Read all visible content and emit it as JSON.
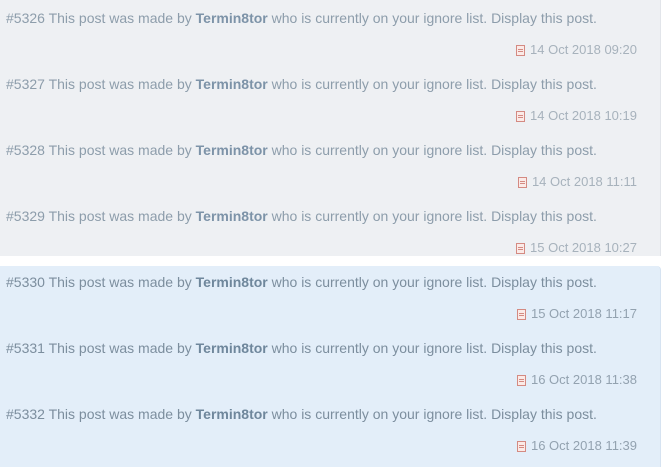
{
  "posts": [
    {
      "number": "#5326",
      "pre": " This post was made by ",
      "author": "Termin8tor",
      "mid": " who is currently on your ignore list. ",
      "display": "Display this post.",
      "date": "14 Oct 2018 09:20"
    },
    {
      "number": "#5327",
      "pre": " This post was made by ",
      "author": "Termin8tor",
      "mid": " who is currently on your ignore list. ",
      "display": "Display this post.",
      "date": "14 Oct 2018 10:19"
    },
    {
      "number": "#5328",
      "pre": " This post was made by ",
      "author": "Termin8tor",
      "mid": " who is currently on your ignore list. ",
      "display": "Display this post.",
      "date": "14 Oct 2018 11:11"
    },
    {
      "number": "#5329",
      "pre": " This post was made by ",
      "author": "Termin8tor",
      "mid": " who is currently on your ignore list. ",
      "display": "Display this post.",
      "date": "15 Oct 2018 10:27"
    },
    {
      "number": "#5330",
      "pre": " This post was made by ",
      "author": "Termin8tor",
      "mid": " who is currently on your ignore list. ",
      "display": "Display this post.",
      "date": "15 Oct 2018 11:17"
    },
    {
      "number": "#5331",
      "pre": " This post was made by ",
      "author": "Termin8tor",
      "mid": " who is currently on your ignore list. ",
      "display": "Display this post.",
      "date": "16 Oct 2018 11:38"
    },
    {
      "number": "#5332",
      "pre": " This post was made by ",
      "author": "Termin8tor",
      "mid": " who is currently on your ignore list. ",
      "display": "Display this post.",
      "date": "16 Oct 2018 11:39"
    }
  ],
  "icons": {
    "post_icon": "document-icon"
  },
  "colors": {
    "grey_panel": "#eef0f3",
    "blue_panel": "#e3eef9",
    "text": "#8d9dab",
    "icon_accent": "#d48a82"
  }
}
